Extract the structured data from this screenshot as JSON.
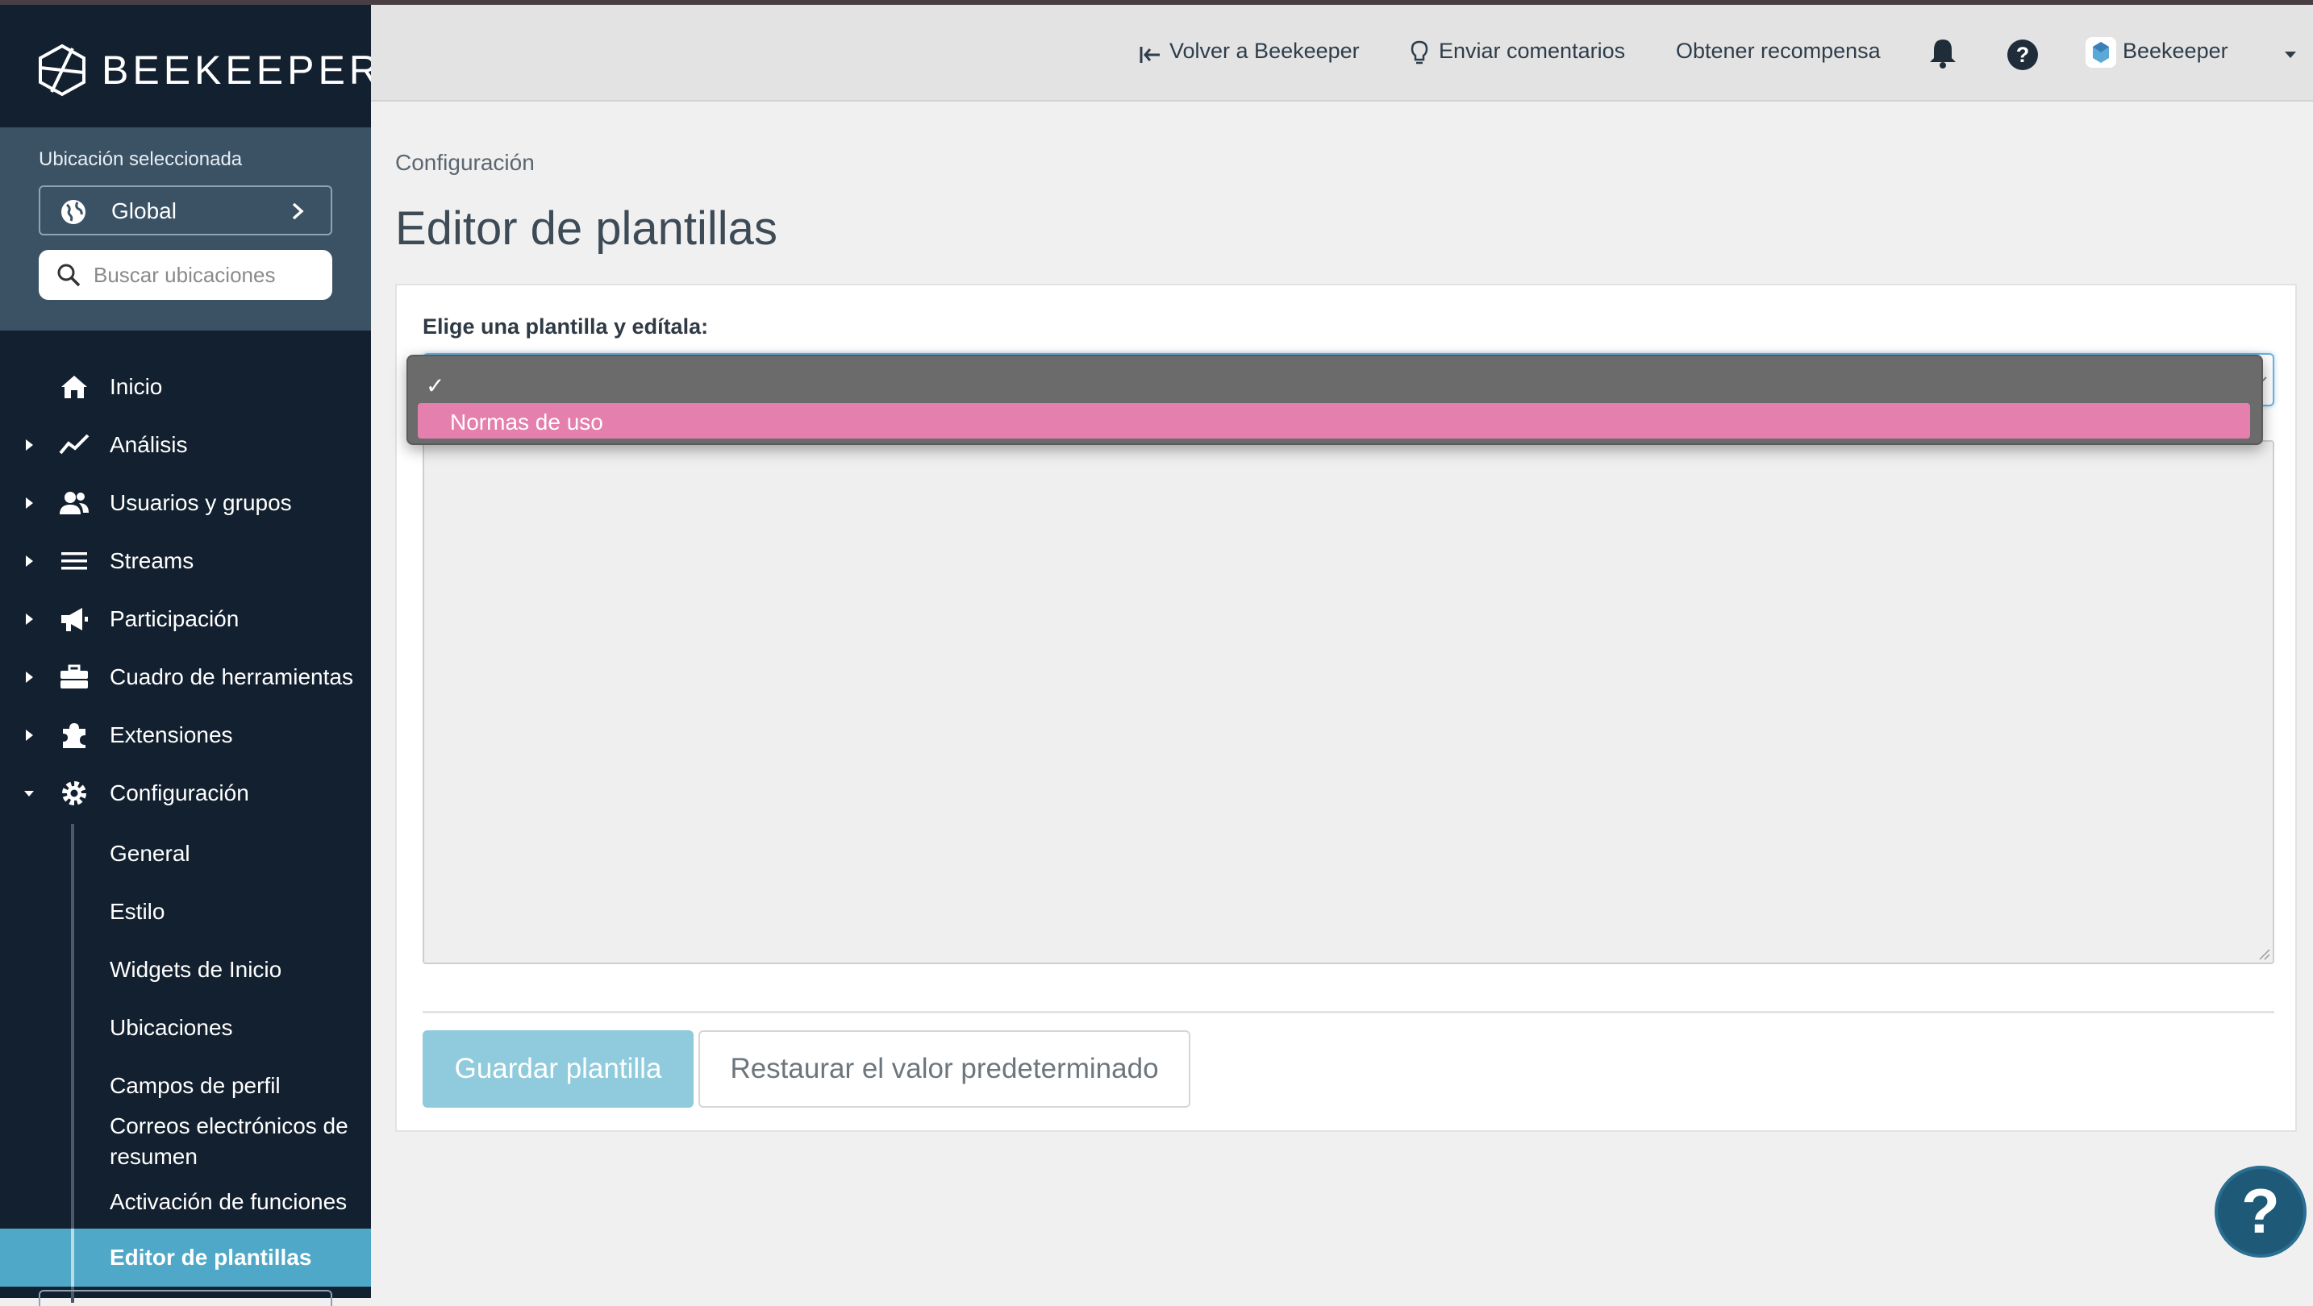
{
  "brand": {
    "name": "BEEKEEPER"
  },
  "location": {
    "label": "Ubicación seleccionada",
    "selected": "Global",
    "search_placeholder": "Buscar ubicaciones"
  },
  "nav": {
    "items": [
      {
        "label": "Inicio",
        "icon": "home-icon"
      },
      {
        "label": "Análisis",
        "icon": "trend-icon"
      },
      {
        "label": "Usuarios y grupos",
        "icon": "users-icon"
      },
      {
        "label": "Streams",
        "icon": "menu-lines-icon"
      },
      {
        "label": "Participación",
        "icon": "megaphone-icon"
      },
      {
        "label": "Cuadro de herramientas",
        "icon": "toolbox-icon"
      },
      {
        "label": "Extensiones",
        "icon": "puzzle-icon"
      },
      {
        "label": "Configuración",
        "icon": "gear-icon"
      }
    ],
    "sub_items": [
      {
        "label": "General"
      },
      {
        "label": "Estilo"
      },
      {
        "label": "Widgets de Inicio"
      },
      {
        "label": "Ubicaciones"
      },
      {
        "label": "Campos de perfil"
      },
      {
        "label": "Correos electrónicos de resumen"
      },
      {
        "label": "Activación de funciones"
      },
      {
        "label": "Editor de plantillas"
      }
    ]
  },
  "topbar": {
    "back": "Volver a Beekeeper",
    "feedback": "Enviar comentarios",
    "reward": "Obtener recompensa",
    "account": "Beekeeper"
  },
  "main": {
    "breadcrumb": "Configuración",
    "title": "Editor de plantillas",
    "select_label": "Elige una plantilla y edítala:",
    "save_label": "Guardar plantilla",
    "restore_label": "Restaurar el valor predeterminado"
  },
  "dropdown": {
    "check": "✓",
    "options": [
      "Normas de uso"
    ]
  },
  "help": {
    "label": "?"
  },
  "colors": {
    "sidebar_bg": "#13202f",
    "location_panel_bg": "#3b5265",
    "active_item_bg": "#4fa8c7",
    "option_highlight": "#e47fae",
    "save_button_bg": "#8fcbdc",
    "help_fab_bg": "#1e5a78"
  }
}
